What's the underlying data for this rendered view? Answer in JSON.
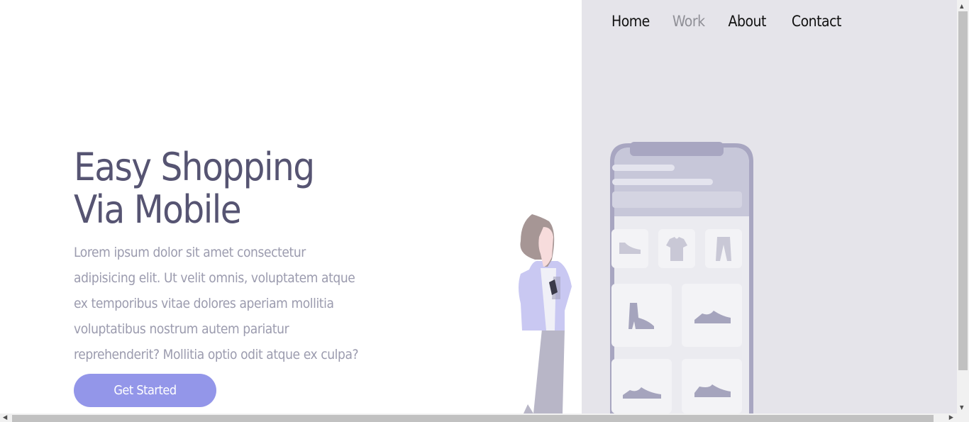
{
  "nav": {
    "items": [
      {
        "label": "Home",
        "active": false
      },
      {
        "label": "Work",
        "active": true
      },
      {
        "label": "About",
        "active": false
      },
      {
        "label": "Contact",
        "active": false
      }
    ]
  },
  "hero": {
    "title_line1": "Easy Shopping",
    "title_line2": "Via Mobile",
    "description": "Lorem ipsum dolor sit amet consectetur adipisicing elit. Ut velit omnis, voluptatem atque ex temporibus vitae dolores aperiam mollitia voluptatibus nostrum autem pariatur reprehenderit? Mollitia optio odit atque ex culpa?",
    "cta_label": "Get Started"
  },
  "colors": {
    "title": "#565472",
    "text": "#9b9bae",
    "accent": "#9396e9",
    "panel": "#e5e4ea",
    "nav_active": "#8f8f96"
  },
  "illustration": {
    "icons": [
      "shoe-icon",
      "tshirt-icon",
      "pants-icon",
      "boot-icon",
      "sneaker-icon",
      "sneaker-icon",
      "sneaker-icon"
    ]
  },
  "scrollbars": {
    "vertical": "scrollbar-vertical",
    "horizontal": "scrollbar-horizontal"
  }
}
